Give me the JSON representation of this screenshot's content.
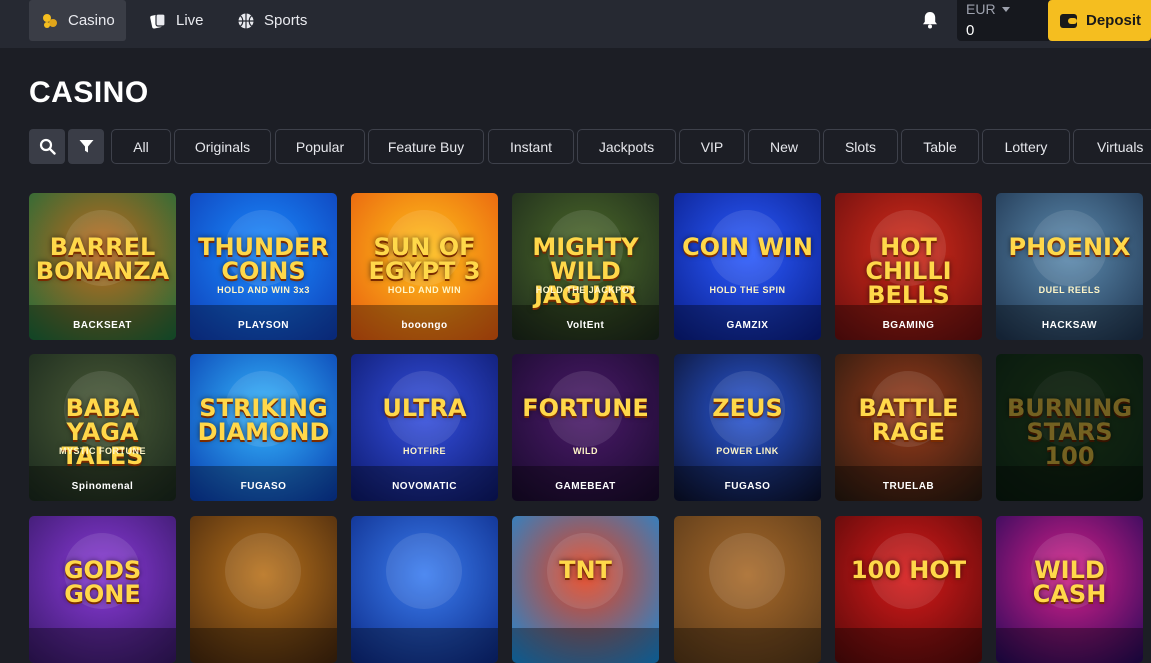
{
  "header": {
    "nav": [
      {
        "label": "Casino",
        "icon": "casino-chips-icon",
        "active": true
      },
      {
        "label": "Live",
        "icon": "live-cards-icon",
        "active": false
      },
      {
        "label": "Sports",
        "icon": "basketball-icon",
        "active": false
      }
    ],
    "wallet": {
      "currency": "EUR",
      "balance": "0"
    },
    "deposit_label": "Deposit"
  },
  "page": {
    "title": "CASINO"
  },
  "filters": {
    "search_icon": "search-icon",
    "filter_icon": "filter-icon",
    "categories": [
      "All",
      "Originals",
      "Popular",
      "Feature Buy",
      "Instant",
      "Jackpots",
      "VIP",
      "New",
      "Slots",
      "Table",
      "Lottery",
      "Virtuals"
    ]
  },
  "games": [
    {
      "title": "Barrel Bonanza",
      "subtitle": "",
      "provider": "BACKSEAT",
      "colors": [
        "#1f6b3a",
        "#c46a1c"
      ]
    },
    {
      "title": "Thunder Coins",
      "subtitle": "HOLD AND WIN 3x3",
      "provider": "PLAYSON",
      "colors": [
        "#0f3fb8",
        "#1a8cff"
      ]
    },
    {
      "title": "Sun of Egypt 3",
      "subtitle": "HOLD AND WIN",
      "provider": "booongo",
      "colors": [
        "#e85d0f",
        "#ffc21a"
      ]
    },
    {
      "title": "Mighty Wild Jaguar",
      "subtitle": "HOLD THE JACKPOT",
      "provider": "VoltEnt",
      "colors": [
        "#1d2a1c",
        "#4d6b2a"
      ]
    },
    {
      "title": "Coin Win",
      "subtitle": "HOLD THE SPIN",
      "provider": "GAMZIX",
      "colors": [
        "#0a1f8c",
        "#2b5bff"
      ]
    },
    {
      "title": "Hot Chilli Bells",
      "subtitle": "",
      "provider": "BGAMING",
      "colors": [
        "#6a0f0f",
        "#d62b1a"
      ]
    },
    {
      "title": "Phoenix",
      "subtitle": "DUEL REELS",
      "provider": "HACKSAW",
      "colors": [
        "#1f3550",
        "#5d8cb0"
      ]
    },
    {
      "title": "Baba Yaga Tales",
      "subtitle": "MYSTIC FORTUNE",
      "provider": "Spinomenal",
      "colors": [
        "#1b2a1e",
        "#4a5a36"
      ]
    },
    {
      "title": "Striking Diamond",
      "subtitle": "",
      "provider": "FUGASO",
      "colors": [
        "#0a3fb0",
        "#35b8ff"
      ]
    },
    {
      "title": "Ultra",
      "subtitle": "HOTFIRE",
      "provider": "NOVOMATIC",
      "colors": [
        "#0d1a6e",
        "#3550e0"
      ]
    },
    {
      "title": "Fortune",
      "subtitle": "WILD",
      "provider": "GAMEBEAT",
      "colors": [
        "#1a0b2e",
        "#4b1a6a"
      ]
    },
    {
      "title": "Zeus",
      "subtitle": "POWER LINK",
      "provider": "FUGASO",
      "colors": [
        "#0b1230",
        "#2a58d8"
      ]
    },
    {
      "title": "Battle Rage",
      "subtitle": "",
      "provider": "TRUELAB",
      "colors": [
        "#2a1a10",
        "#9b3b1a"
      ]
    },
    {
      "title": "Burning Stars 100",
      "subtitle": "",
      "provider": "",
      "colors": [
        "#123820",
        "#2e5a28"
      ]
    },
    {
      "title": "Gods Gone",
      "subtitle": "",
      "provider": "",
      "colors": [
        "#3a1a6b",
        "#8a3ad8"
      ]
    },
    {
      "title": "",
      "subtitle": "",
      "provider": "",
      "colors": [
        "#4a2a0e",
        "#b8721c"
      ]
    },
    {
      "title": "",
      "subtitle": "",
      "provider": "",
      "colors": [
        "#0d2c8a",
        "#3b7df0"
      ]
    },
    {
      "title": "TNT",
      "subtitle": "",
      "provider": "",
      "colors": [
        "#1a8ad8",
        "#e8401a"
      ]
    },
    {
      "title": "",
      "subtitle": "",
      "provider": "",
      "colors": [
        "#5a3a1a",
        "#a86a2a"
      ]
    },
    {
      "title": "100 Hot",
      "subtitle": "",
      "provider": "",
      "colors": [
        "#5a0a0a",
        "#d81a1a"
      ]
    },
    {
      "title": "Wild Cash",
      "subtitle": "",
      "provider": "",
      "colors": [
        "#2a0a5a",
        "#d8208a"
      ]
    }
  ]
}
